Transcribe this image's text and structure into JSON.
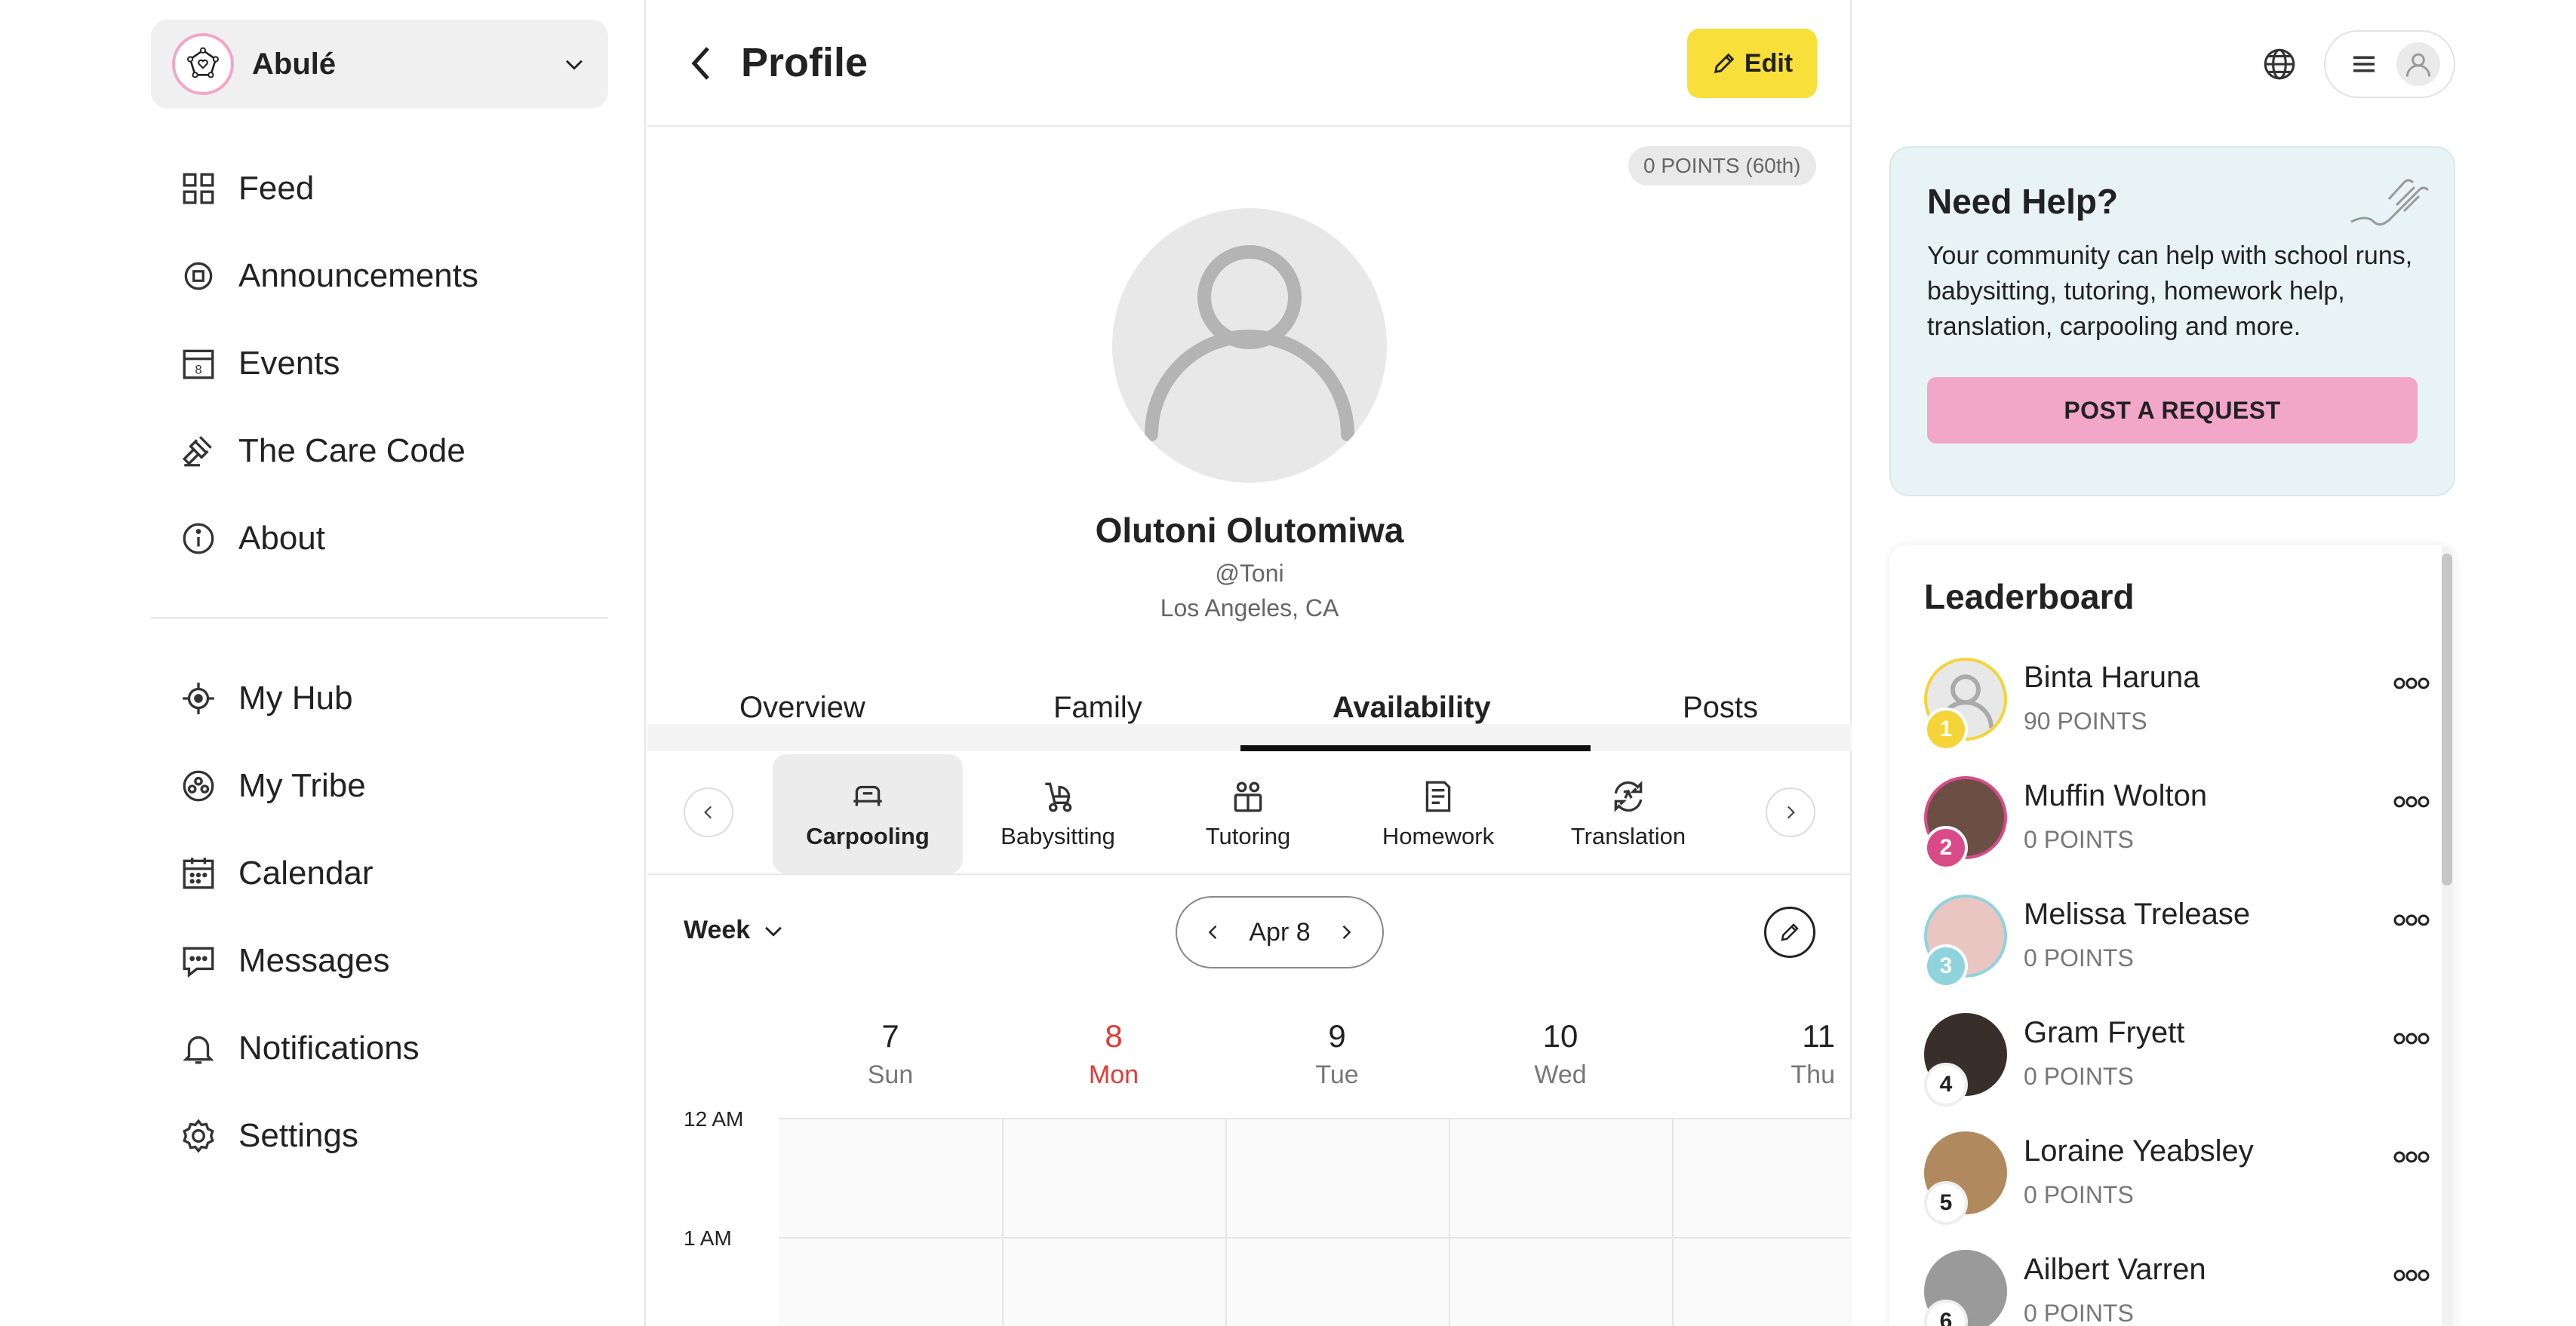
{
  "colors": {
    "accent_yellow": "#f8df3a",
    "accent_pink": "#f2a6c8",
    "today_red": "#e53935",
    "help_bg": "#e7f3f4"
  },
  "sidebar": {
    "org_name": "Abulé",
    "org_logo_icon": "pentagon-heart-logo",
    "items_primary": [
      {
        "label": "Feed",
        "icon": "grid-icon"
      },
      {
        "label": "Announcements",
        "icon": "megaphone-icon"
      },
      {
        "label": "Events",
        "icon": "calendar-date-icon"
      },
      {
        "label": "The Care Code",
        "icon": "gavel-icon"
      },
      {
        "label": "About",
        "icon": "info-icon"
      }
    ],
    "items_secondary": [
      {
        "label": "My Hub",
        "icon": "hub-icon"
      },
      {
        "label": "My Tribe",
        "icon": "tribe-icon"
      },
      {
        "label": "Calendar",
        "icon": "calendar-icon"
      },
      {
        "label": "Messages",
        "icon": "chat-icon"
      },
      {
        "label": "Notifications",
        "icon": "bell-icon"
      },
      {
        "label": "Settings",
        "icon": "gear-icon"
      }
    ]
  },
  "header": {
    "title": "Profile",
    "edit_label": "Edit"
  },
  "profile": {
    "points_chip": "0 POINTS (60th)",
    "name": "Olutoni Olutomiwa",
    "handle": "@Toni",
    "location": "Los Angeles, CA"
  },
  "tabs": [
    {
      "label": "Overview",
      "active": false
    },
    {
      "label": "Family",
      "active": false
    },
    {
      "label": "Availability",
      "active": true
    },
    {
      "label": "Posts",
      "active": false
    }
  ],
  "services": [
    {
      "label": "Carpooling",
      "icon": "car-seat-icon",
      "active": true
    },
    {
      "label": "Babysitting",
      "icon": "stroller-icon",
      "active": false
    },
    {
      "label": "Tutoring",
      "icon": "tutoring-icon",
      "active": false
    },
    {
      "label": "Homework",
      "icon": "homework-icon",
      "active": false
    },
    {
      "label": "Translation",
      "icon": "translation-icon",
      "active": false
    }
  ],
  "calendar": {
    "view": "Week",
    "current_date": "Apr 8",
    "days": [
      {
        "num": "7",
        "name": "Sun",
        "today": false
      },
      {
        "num": "8",
        "name": "Mon",
        "today": true
      },
      {
        "num": "9",
        "name": "Tue",
        "today": false
      },
      {
        "num": "10",
        "name": "Wed",
        "today": false
      },
      {
        "num": "11",
        "name": "Thu",
        "today": false
      }
    ],
    "times": [
      "12 AM",
      "1 AM"
    ]
  },
  "help": {
    "title": "Need Help?",
    "text": "Your community can help with school runs, babysitting, tutoring, homework help, translation, carpooling and more.",
    "button": "POST A REQUEST"
  },
  "leaderboard": {
    "title": "Leaderboard",
    "entries": [
      {
        "rank": "1",
        "name": "Binta Haruna",
        "points": "90 POINTS",
        "rank_color": "#f5d43a",
        "avatar_color": "#e8e8e8"
      },
      {
        "rank": "2",
        "name": "Muffin Wolton",
        "points": "0 POINTS",
        "rank_color": "#d94b86",
        "avatar_color": "#6b4f45"
      },
      {
        "rank": "3",
        "name": "Melissa Trelease",
        "points": "0 POINTS",
        "rank_color": "#8fd3dc",
        "avatar_color": "#e9c6c2"
      },
      {
        "rank": "4",
        "name": "Gram Fryett",
        "points": "0 POINTS",
        "rank_color": "#ffffff",
        "avatar_color": "#3a2e2b"
      },
      {
        "rank": "5",
        "name": "Loraine Yeabsley",
        "points": "0 POINTS",
        "rank_color": "#ffffff",
        "avatar_color": "#b08a5e"
      },
      {
        "rank": "6",
        "name": "Ailbert Varren",
        "points": "0 POINTS",
        "rank_color": "#ffffff",
        "avatar_color": "#9a9a9a"
      }
    ]
  }
}
